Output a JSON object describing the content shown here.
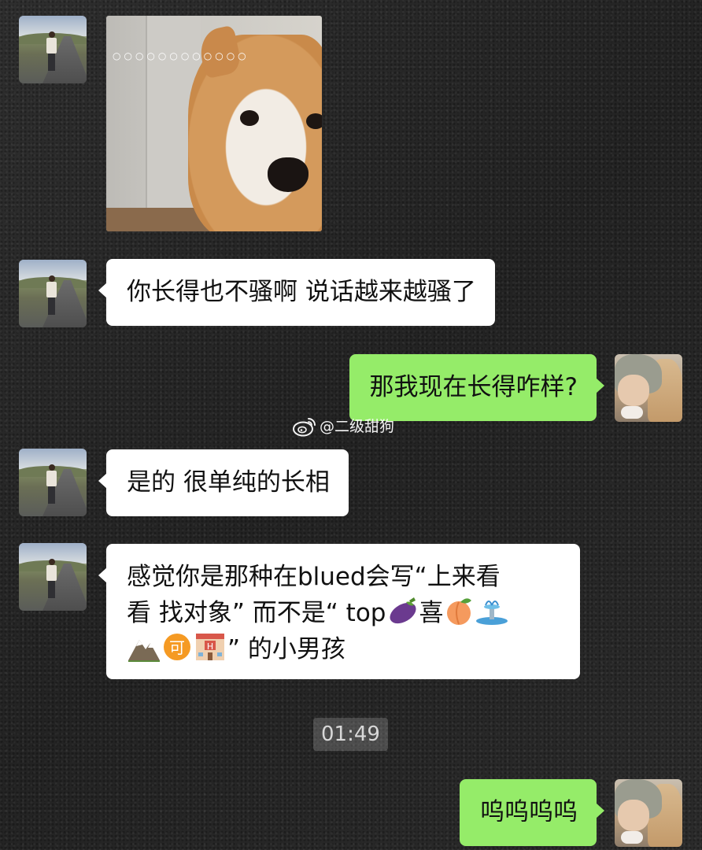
{
  "chat": {
    "sticker_dots": "○○○○○○○○○○○○",
    "msg1": "你长得也不骚啊 说话越来越骚了",
    "msg2": "那我现在长得咋样?",
    "msg3": "是的 很单纯的长相",
    "msg4_line1": "感觉你是那种在blued会写“上来看",
    "msg4_line2_a": "看 找对象” 而不是“ top",
    "msg4_line2_b": "喜",
    "msg4_line3": "” 的小男孩",
    "msg5": "呜呜呜呜",
    "timestamp": "01:49"
  },
  "watermark": {
    "handle": "@二级甜狗"
  },
  "icons": {
    "eggplant": "eggplant-emoji",
    "peach": "peach-emoji",
    "fountain": "fountain-emoji",
    "mountain": "mountain-emoji",
    "ke": "acceptable-button-emoji",
    "hotel": "hotel-emoji"
  },
  "colors": {
    "incoming_bubble": "#ffffff",
    "outgoing_bubble": "#95ec69",
    "background": "#2a2a2a"
  }
}
